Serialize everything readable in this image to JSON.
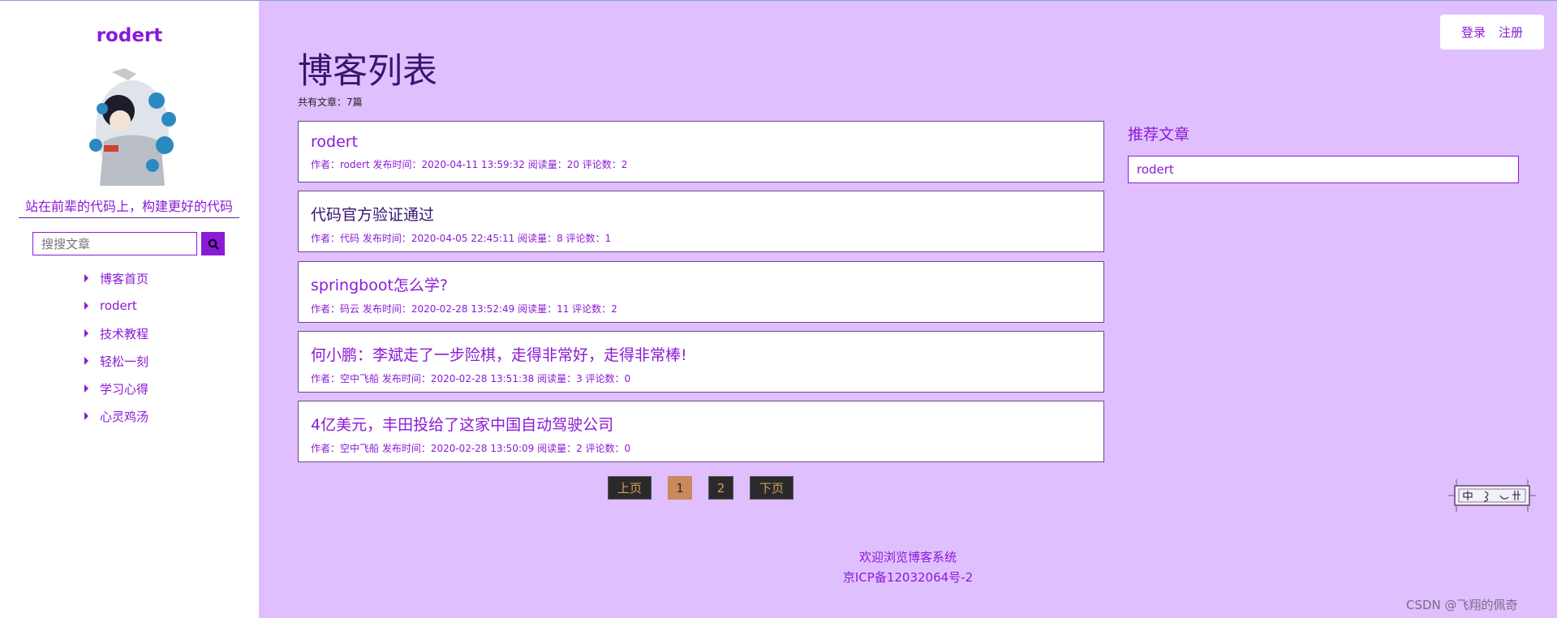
{
  "sidebar": {
    "site_name": "rodert",
    "motto": "站在前辈的代码上，构建更好的代码",
    "search_placeholder": "搜搜文章",
    "nav": [
      "博客首页",
      "rodert",
      "技术教程",
      "轻松一刻",
      "学习心得",
      "心灵鸡汤"
    ]
  },
  "auth": {
    "login": "登录",
    "register": "注册"
  },
  "main": {
    "title": "博客列表",
    "count": "共有文章：7篇",
    "articles": [
      {
        "title": "rodert",
        "meta": "作者：rodert 发布时间：2020-04-11 13:59:32 阅读量：20 评论数：2"
      },
      {
        "title": "代码官方验证通过",
        "meta": "作者：代码 发布时间：2020-04-05 22:45:11 阅读量：8 评论数：1"
      },
      {
        "title": "springboot怎么学?",
        "meta": "作者：码云 发布时间：2020-02-28 13:52:49 阅读量：11 评论数：2"
      },
      {
        "title": "何小鹏：李斌走了一步险棋，走得非常好，走得非常棒!",
        "meta": "作者：空中飞船 发布时间：2020-02-28 13:51:38 阅读量：3 评论数：0"
      },
      {
        "title": "4亿美元，丰田投给了这家中国自动驾驶公司",
        "meta": "作者：空中飞船 发布时间：2020-02-28 13:50:09 阅读量：2 评论数：0"
      }
    ]
  },
  "recommend": {
    "heading": "推荐文章",
    "items": [
      "rodert"
    ]
  },
  "pagination": {
    "prev": "上页",
    "pages": [
      "1",
      "2"
    ],
    "next": "下页",
    "current": "1"
  },
  "footer": {
    "line1": "欢迎浏览博客系统",
    "line2": "京ICP备12032064号-2"
  },
  "watermark": "CSDN @飞翔的佩奇",
  "colors": {
    "accent": "#8a1ad6",
    "background": "#e0bfff",
    "pager_bg": "#2a2a2a",
    "pager_active": "#c88a5a"
  }
}
